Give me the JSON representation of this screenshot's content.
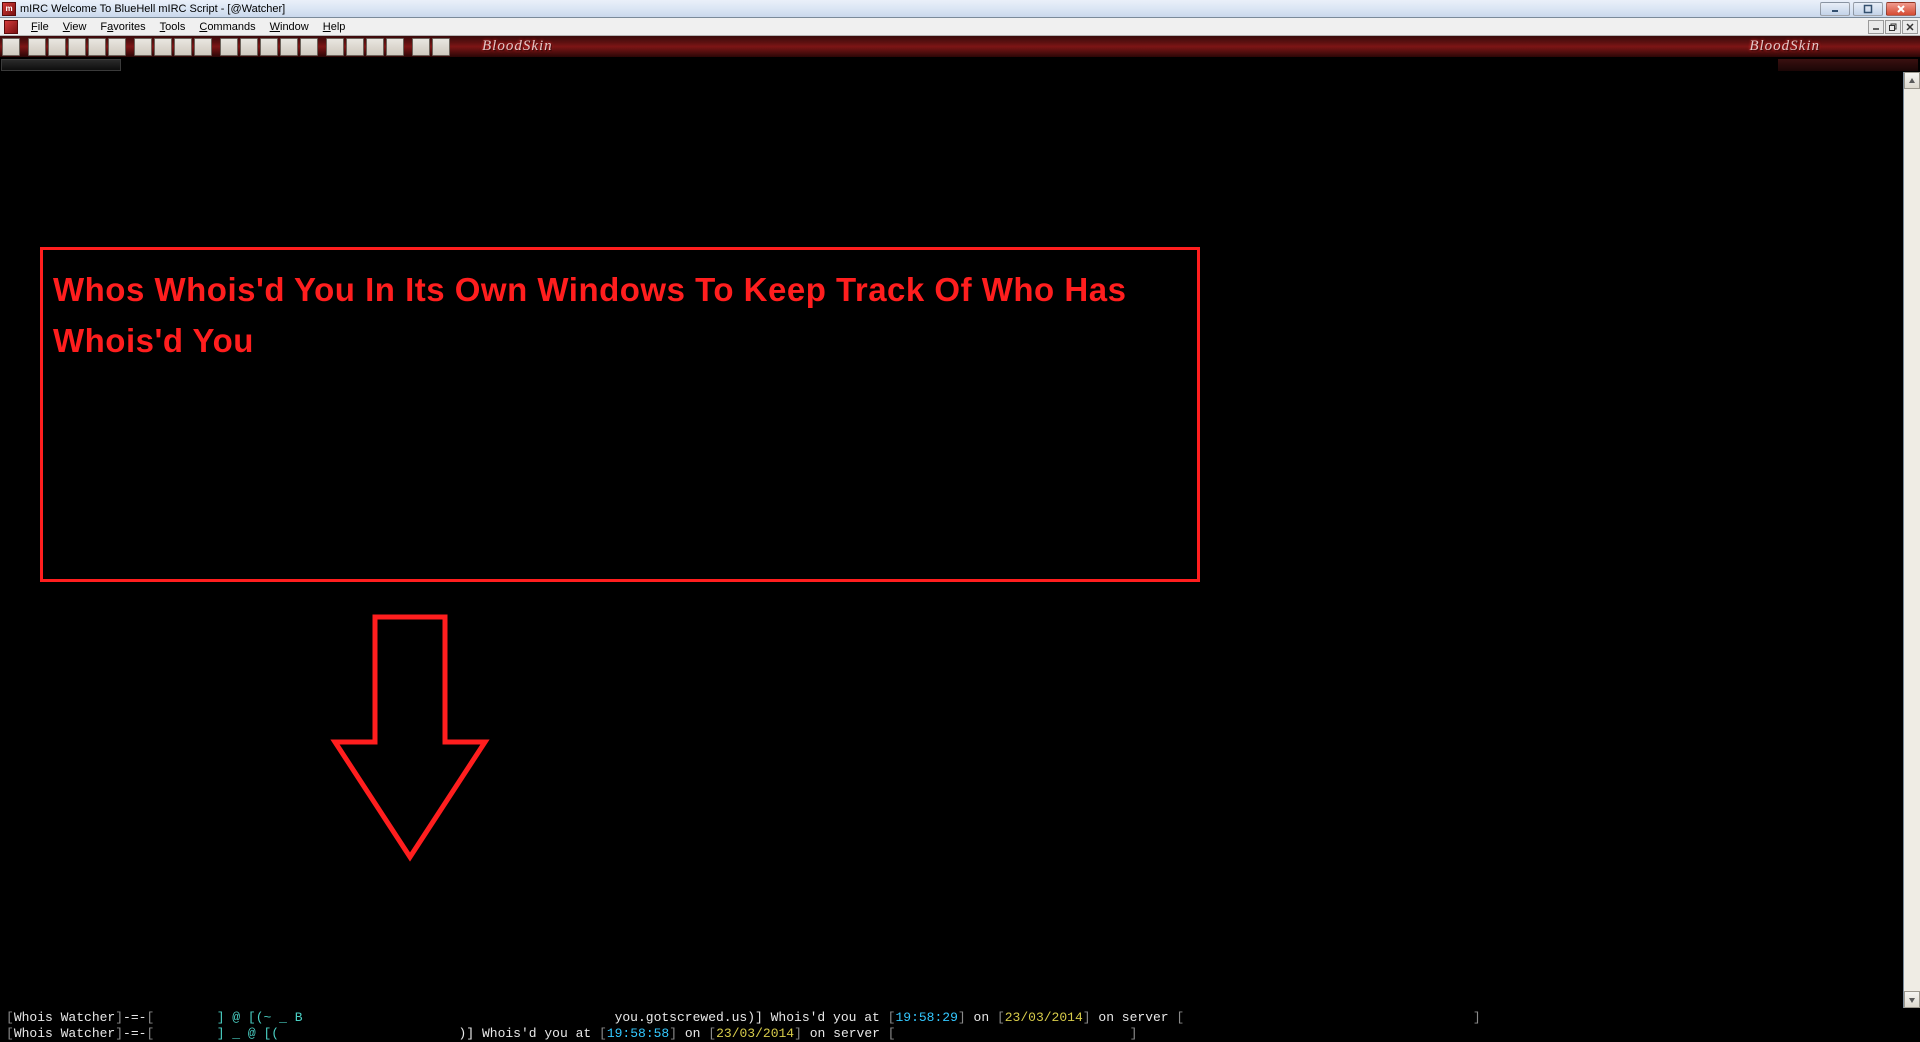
{
  "window": {
    "title": "mIRC Welcome To BlueHell mIRC Script - [@Watcher]",
    "app_icon_letter": "m"
  },
  "menus": {
    "file": "File",
    "view": "View",
    "favorites": "Favorites",
    "tools": "Tools",
    "commands": "Commands",
    "window": "Window",
    "help": "Help"
  },
  "skin": {
    "brand": "BloodSkin"
  },
  "callout": {
    "text": "Whos Whois'd You In Its Own Windows To Keep Track Of Who Has Whois'd You"
  },
  "logs": [
    {
      "tag": "Whois Watcher",
      "sep": "-=-",
      "nick_prefix": "] @ [(~ _ B",
      "host": "you.gotscrewed.us)]",
      "action": "Whois'd you at",
      "time": "19:58:29",
      "on": "on",
      "date": "23/03/2014",
      "server_label": "on server",
      "server": ""
    },
    {
      "tag": "Whois Watcher",
      "sep": "-=-",
      "nick_prefix": "] _ @ [(",
      "host": ")]",
      "action": "Whois'd you at",
      "time": "19:58:58",
      "on": "on",
      "date": "23/03/2014",
      "server_label": "on server",
      "server": ""
    }
  ]
}
